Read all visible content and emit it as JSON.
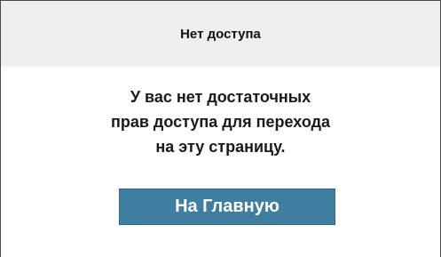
{
  "dialog": {
    "title": "Нет доступа",
    "message_lines": [
      "У вас нет достаточных",
      "прав доступа для перехода",
      "на эту страницу."
    ],
    "home_button_label": "На Главную"
  },
  "colors": {
    "header_bg": "#efefef",
    "button_bg": "#3e7fa0",
    "button_text": "#ffffff",
    "border": "#4a4a4a"
  }
}
